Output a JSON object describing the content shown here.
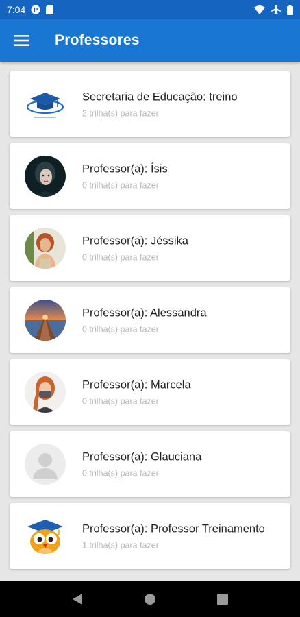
{
  "status_bar": {
    "time": "7:04",
    "icons": [
      "notification-icon",
      "sd-card-icon",
      "wifi-icon",
      "airplane-icon",
      "battery-icon"
    ]
  },
  "app_bar": {
    "title": "Professores",
    "menu_icon": "hamburger-menu-icon",
    "color": "#1976d2"
  },
  "professors": [
    {
      "title": "Secretaria de Educação: treino",
      "subtitle": "2 trilha(s) para fazer",
      "avatar": "graduation-cap-logo"
    },
    {
      "title": "Professor(a): Ísis",
      "subtitle": "0 trilha(s) para fazer",
      "avatar": "photo-woman-dark"
    },
    {
      "title": "Professor(a): Jéssika",
      "subtitle": "0 trilha(s) para fazer",
      "avatar": "photo-woman-redhair"
    },
    {
      "title": "Professor(a): Alessandra",
      "subtitle": "0 trilha(s) para fazer",
      "avatar": "photo-pier-sunset"
    },
    {
      "title": "Professor(a): Marcela",
      "subtitle": "0 trilha(s) para fazer",
      "avatar": "photo-woman-mask"
    },
    {
      "title": "Professor(a): Glauciana",
      "subtitle": "0 trilha(s) para fazer",
      "avatar": "default-person-icon"
    },
    {
      "title": "Professor(a): Professor Treinamento",
      "subtitle": "1 trilha(s) para fazer",
      "avatar": "owl-mascot-icon"
    }
  ],
  "nav_bar": {
    "buttons": [
      "back-icon",
      "home-icon",
      "recents-icon"
    ]
  }
}
